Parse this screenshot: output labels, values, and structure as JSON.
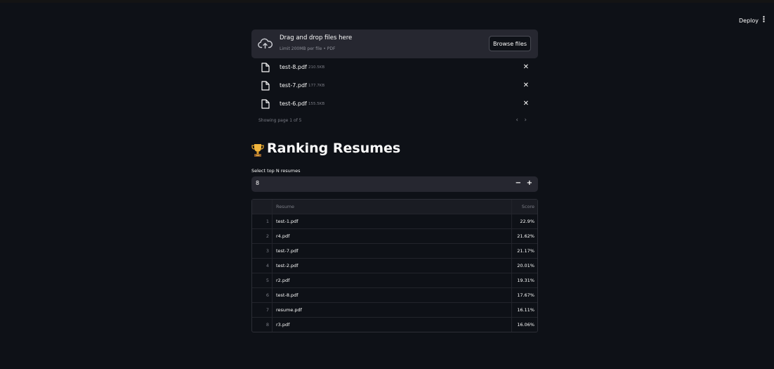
{
  "header": {
    "deploy_label": "Deploy",
    "menu_icon": "⋮"
  },
  "uploader": {
    "icon": "upload-cloud-icon",
    "title": "Drag and drop files here",
    "limit": "Limit 200MB per file • PDF",
    "browse_label": "Browse files",
    "files": [
      {
        "name": "test-8.pdf",
        "size": "210.5KB"
      },
      {
        "name": "test-7.pdf",
        "size": "177.7KB"
      },
      {
        "name": "test-6.pdf",
        "size": "155.5KB"
      }
    ],
    "pager_text": "Showing page 1 of 5",
    "prev": "‹",
    "next": "›"
  },
  "ranking": {
    "icon": "trophy-icon",
    "title": "Ranking Resumes",
    "select_label": "Select top N resumes",
    "value": "8",
    "minus": "−",
    "plus": "+",
    "columns": {
      "resume": "Resume",
      "score": "Score"
    },
    "rows": [
      {
        "idx": "1",
        "resume": "test-1.pdf",
        "score": "22.9%"
      },
      {
        "idx": "2",
        "resume": "r4.pdf",
        "score": "21.62%"
      },
      {
        "idx": "3",
        "resume": "test-7.pdf",
        "score": "21.17%"
      },
      {
        "idx": "4",
        "resume": "test-2.pdf",
        "score": "20.01%"
      },
      {
        "idx": "5",
        "resume": "r2.pdf",
        "score": "19.31%"
      },
      {
        "idx": "6",
        "resume": "test-8.pdf",
        "score": "17.67%"
      },
      {
        "idx": "7",
        "resume": "resume.pdf",
        "score": "16.11%"
      },
      {
        "idx": "8",
        "resume": "r3.pdf",
        "score": "16.06%"
      }
    ]
  },
  "colors": {
    "background": "#0e1117",
    "widget": "#262730",
    "text": "#fafafa",
    "muted": "#7a7c85"
  }
}
